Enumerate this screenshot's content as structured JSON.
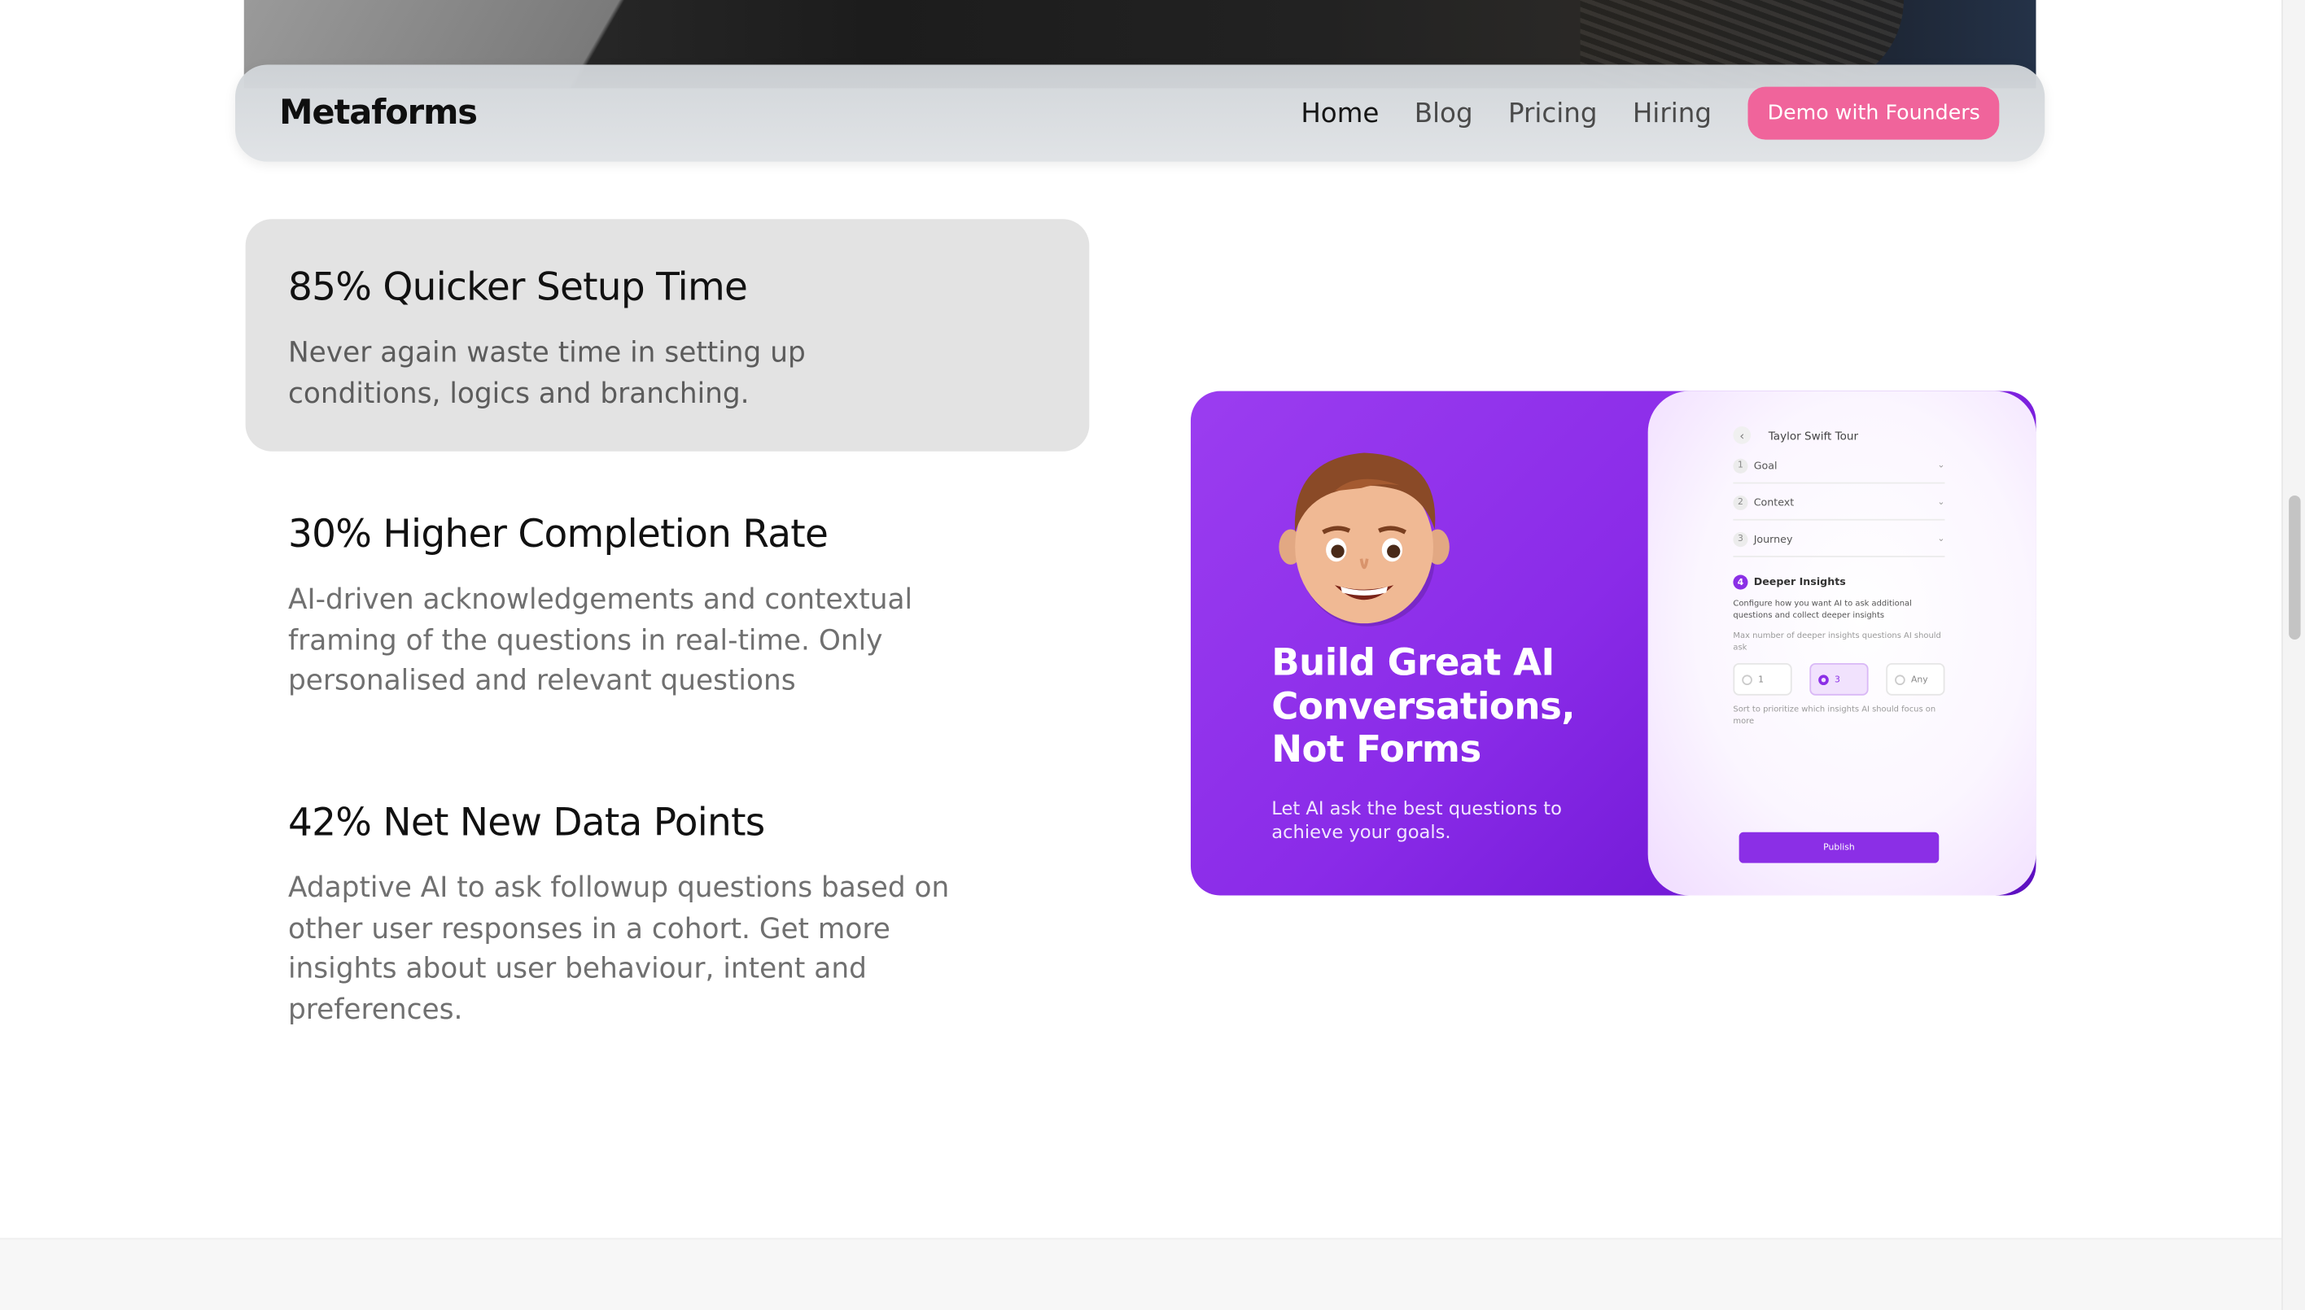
{
  "nav": {
    "logo": "Metaforms",
    "links": [
      "Home",
      "Blog",
      "Pricing",
      "Hiring"
    ],
    "cta": "Demo with Founders"
  },
  "features": [
    {
      "title": "85% Quicker Setup Time",
      "description": "Never again waste time in setting up conditions, logics and branching."
    },
    {
      "title": "30% Higher Completion Rate",
      "description": "AI-driven acknowledgements and contextual framing of the questions in real-time. Only personalised and relevant questions"
    },
    {
      "title": "42% Net New Data Points",
      "description": "Adaptive AI to ask followup questions based on other user responses in a cohort. Get more insights about user behaviour, intent and preferences."
    }
  ],
  "promo": {
    "title": "Build Great AI Conversations, Not Forms",
    "subtitle": "Let AI ask the best questions to achieve your goals.",
    "phone": {
      "header": "Taylor Swift Tour",
      "steps": [
        {
          "num": "1",
          "label": "Goal"
        },
        {
          "num": "2",
          "label": "Context"
        },
        {
          "num": "3",
          "label": "Journey"
        }
      ],
      "active_step": {
        "num": "4",
        "label": "Deeper Insights"
      },
      "description": "Configure how you want AI to ask additional questions and collect deeper insights",
      "max_label": "Max number of deeper insights questions AI should ask",
      "options": [
        "1",
        "3",
        "Any"
      ],
      "selected_option": "3",
      "sort_hint": "Sort to prioritize which insights AI should focus on more",
      "publish": "Publish"
    }
  },
  "colors": {
    "cta": "#f0649b",
    "promo_purple": "#8a2be8"
  }
}
